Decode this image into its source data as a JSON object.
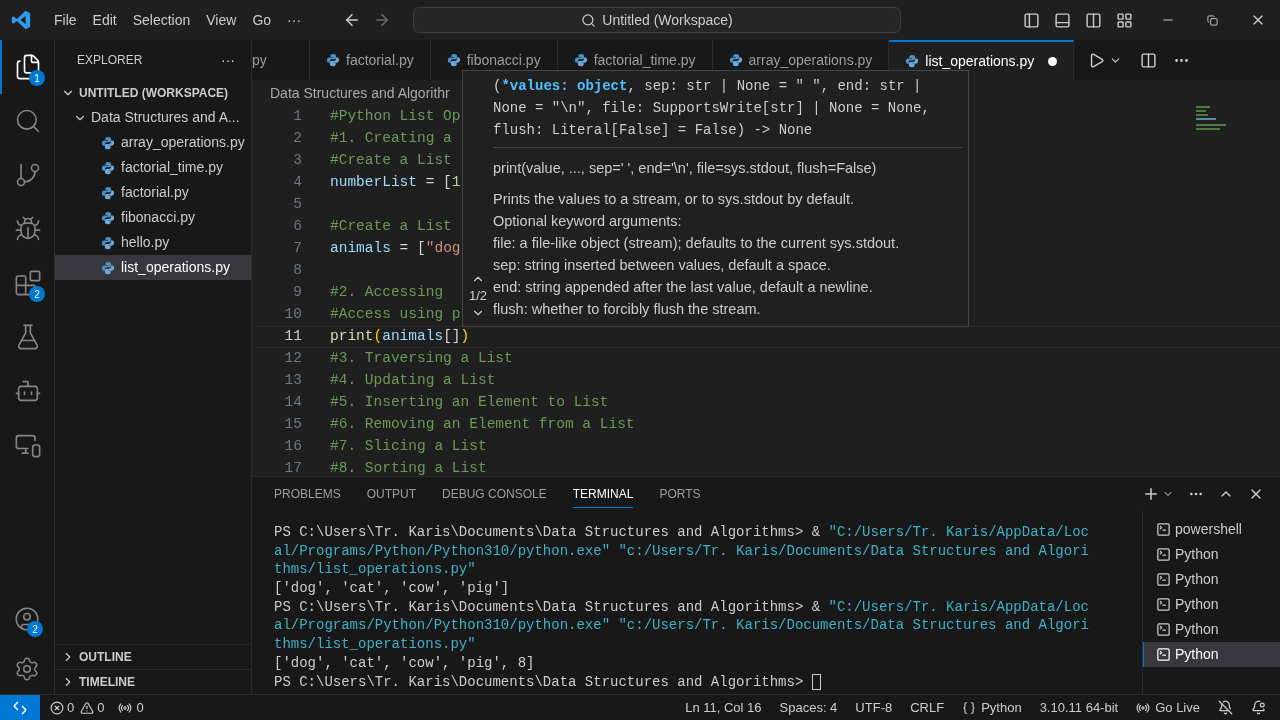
{
  "menu": [
    "File",
    "Edit",
    "Selection",
    "View",
    "Go",
    "···"
  ],
  "command_center": {
    "text": "Untitled (Workspace)"
  },
  "activity_bar": [
    {
      "badge": "1",
      "selected": true
    },
    {
      "selected": false
    },
    {
      "selected": false
    },
    {
      "selected": false
    },
    {
      "badge": "2",
      "selected": false
    },
    {
      "selected": false
    },
    {
      "selected": false
    },
    {
      "selected": false
    }
  ],
  "account_badge": "2",
  "sidebar": {
    "title": "EXPLORER",
    "more": "···",
    "tree": [
      {
        "label": "UNTITLED (WORKSPACE)",
        "kind": "root",
        "expanded": true,
        "children": [
          {
            "label": "Data Structures and A...",
            "kind": "folder",
            "expanded": true,
            "children": [
              {
                "label": "array_operations.py",
                "kind": "file",
                "selected": false
              },
              {
                "label": "factorial_time.py",
                "kind": "file",
                "selected": false
              },
              {
                "label": "factorial.py",
                "kind": "file",
                "selected": false
              },
              {
                "label": "fibonacci.py",
                "kind": "file",
                "selected": false
              },
              {
                "label": "hello.py",
                "kind": "file",
                "selected": false
              },
              {
                "label": "list_operations.py",
                "kind": "file",
                "selected": true
              }
            ]
          }
        ]
      }
    ],
    "sections": [
      {
        "label": "OUTLINE",
        "expanded": false
      },
      {
        "label": "TIMELINE",
        "expanded": false
      }
    ]
  },
  "tabs": [
    {
      "label": "py",
      "selected": false,
      "modified": false,
      "cut": true
    },
    {
      "label": "factorial.py",
      "selected": false,
      "modified": false
    },
    {
      "label": "fibonacci.py",
      "selected": false,
      "modified": false
    },
    {
      "label": "factorial_time.py",
      "selected": false,
      "modified": false
    },
    {
      "label": "array_operations.py",
      "selected": false,
      "modified": false
    },
    {
      "label": "list_operations.py",
      "selected": true,
      "modified": true
    }
  ],
  "breadcrumb": "Data Structures and Algorithr",
  "code": [
    {
      "n": "1",
      "current": false,
      "tokens": [
        {
          "t": "#Python List Op",
          "kind": "comment"
        }
      ]
    },
    {
      "n": "2",
      "current": false,
      "tokens": [
        {
          "t": "#1. Creating a",
          "kind": "comment"
        }
      ]
    },
    {
      "n": "3",
      "current": false,
      "tokens": [
        {
          "t": "#Create a List",
          "kind": "comment"
        }
      ]
    },
    {
      "n": "4",
      "current": false,
      "tokens": [
        {
          "t": "numberList",
          "kind": "var"
        },
        {
          "t": " = [",
          "kind": "plain"
        },
        {
          "t": "1",
          "kind": "num"
        }
      ]
    },
    {
      "n": "5",
      "current": false
    },
    {
      "n": "6",
      "current": false,
      "tokens": [
        {
          "t": "#Create a List",
          "kind": "comment"
        }
      ]
    },
    {
      "n": "7",
      "current": false,
      "tokens": [
        {
          "t": "animals",
          "kind": "var"
        },
        {
          "t": " = [",
          "kind": "plain"
        },
        {
          "t": "\"dog",
          "kind": "str"
        }
      ]
    },
    {
      "n": "8",
      "current": false
    },
    {
      "n": "9",
      "current": false,
      "tokens": [
        {
          "t": "#2. Accessing",
          "kind": "comment"
        }
      ]
    },
    {
      "n": "10",
      "current": false,
      "tokens": [
        {
          "t": "#Access using p",
          "kind": "comment"
        }
      ]
    },
    {
      "n": "11",
      "current": true,
      "tokens": [
        {
          "t": "print",
          "kind": "func"
        },
        {
          "t": "(",
          "kind": "bracket"
        },
        {
          "t": "animals",
          "kind": "var"
        },
        {
          "t": "[]",
          "kind": "plain"
        },
        {
          "t": ")",
          "kind": "bracket"
        }
      ]
    },
    {
      "n": "12",
      "current": false,
      "tokens": [
        {
          "t": "#3. Traversing a List",
          "kind": "comment"
        }
      ]
    },
    {
      "n": "13",
      "current": false,
      "tokens": [
        {
          "t": "#4. Updating a List",
          "kind": "comment"
        }
      ]
    },
    {
      "n": "14",
      "current": false,
      "tokens": [
        {
          "t": "#5. Inserting an Element to List",
          "kind": "comment"
        }
      ]
    },
    {
      "n": "15",
      "current": false,
      "tokens": [
        {
          "t": "#6. Removing an Element from a List",
          "kind": "comment"
        }
      ]
    },
    {
      "n": "16",
      "current": false,
      "tokens": [
        {
          "t": "#7. Slicing a List",
          "kind": "comment"
        }
      ]
    },
    {
      "n": "17",
      "current": false,
      "tokens": [
        {
          "t": "#8. Sorting a List",
          "kind": "comment"
        }
      ]
    }
  ],
  "hover": {
    "counter": "1/2",
    "signature_open": "(",
    "active_param": "*values: object",
    "signature_rest": ", sep: str | None = \" \", end: str | None = \"\\n\", file: SupportsWrite[str] | None = None, flush: Literal[False] = False) -> None",
    "usage": "print(value, ..., sep=' ', end='\\n', file=sys.stdout, flush=False)",
    "doc": [
      "Prints the values to a stream, or to sys.stdout by default.",
      "Optional keyword arguments:",
      "file: a file-like object (stream); defaults to the current sys.stdout.",
      "sep: string inserted between values, default a space.",
      "end: string appended after the last value, default a newline.",
      "flush: whether to forcibly flush the stream."
    ]
  },
  "panel": {
    "tabs": [
      {
        "label": "PROBLEMS",
        "selected": false
      },
      {
        "label": "OUTPUT",
        "selected": false
      },
      {
        "label": "DEBUG CONSOLE",
        "selected": false
      },
      {
        "label": "TERMINAL",
        "selected": true
      },
      {
        "label": "PORTS",
        "selected": false
      }
    ],
    "terminal": [
      [
        {
          "t": "PS C:\\Users\\Tr. Karis\\Documents\\Data Structures and Algorithms> & ",
          "kind": "plain"
        },
        {
          "t": "\"C:/Users/Tr. Karis/AppData/Loc",
          "kind": "str"
        }
      ],
      [
        {
          "t": "al/Programs/Python/Python310/python.exe\" \"c:/Users/Tr. Karis/Documents/Data Structures and Algori",
          "kind": "str"
        }
      ],
      [
        {
          "t": "thms/list_operations.py\"",
          "kind": "str"
        }
      ],
      [
        {
          "t": "['dog', 'cat', 'cow', 'pig']",
          "kind": "plain"
        }
      ],
      [
        {
          "t": "PS C:\\Users\\Tr. Karis\\Documents\\Data Structures and Algorithms> & ",
          "kind": "plain"
        },
        {
          "t": "\"C:/Users/Tr. Karis/AppData/Loc",
          "kind": "str"
        }
      ],
      [
        {
          "t": "al/Programs/Python/Python310/python.exe\" \"c:/Users/Tr. Karis/Documents/Data Structures and Algori",
          "kind": "str"
        }
      ],
      [
        {
          "t": "thms/list_operations.py\"",
          "kind": "str"
        }
      ],
      [
        {
          "t": "['dog', 'cat', 'cow', 'pig', 8]",
          "kind": "plain"
        }
      ],
      [
        {
          "t": "PS C:\\Users\\Tr. Karis\\Documents\\Data Structures and Algorithms> ",
          "kind": "plain"
        }
      ]
    ],
    "cursor_visible": true,
    "sessions": [
      {
        "label": "powershell",
        "selected": false
      },
      {
        "label": "Python",
        "selected": false
      },
      {
        "label": "Python",
        "selected": false
      },
      {
        "label": "Python",
        "selected": false
      },
      {
        "label": "Python",
        "selected": false
      },
      {
        "label": "Python",
        "selected": true
      }
    ]
  },
  "status": {
    "errors": "0",
    "warnings": "0",
    "ports": "0",
    "right": [
      {
        "text": "Ln 11, Col 16",
        "kind": "plain"
      },
      {
        "text": "Spaces: 4",
        "kind": "plain"
      },
      {
        "text": "UTF-8",
        "kind": "plain"
      },
      {
        "text": "CRLF",
        "kind": "plain"
      },
      {
        "text": "Python",
        "kind": "language"
      },
      {
        "text": "3.10.11 64-bit",
        "kind": "plain"
      },
      {
        "text": "Go Live",
        "kind": "live"
      }
    ]
  }
}
